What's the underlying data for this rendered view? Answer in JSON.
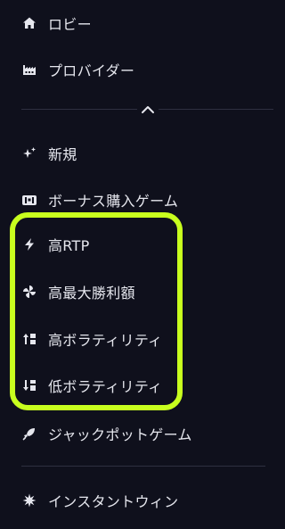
{
  "nav": {
    "lobby": "ロビー",
    "providers": "プロバイダー",
    "new": "新規",
    "bonus_buy": "ボーナス購入ゲーム",
    "high_rtp": "高RTP",
    "highest_win": "高最大勝利額",
    "high_volatility": "高ボラティリティ",
    "low_volatility": "低ボラティリティ",
    "jackpot": "ジャックポットゲーム",
    "instant_win": "インスタントウィン"
  },
  "highlight_color": "#c8ff1e"
}
